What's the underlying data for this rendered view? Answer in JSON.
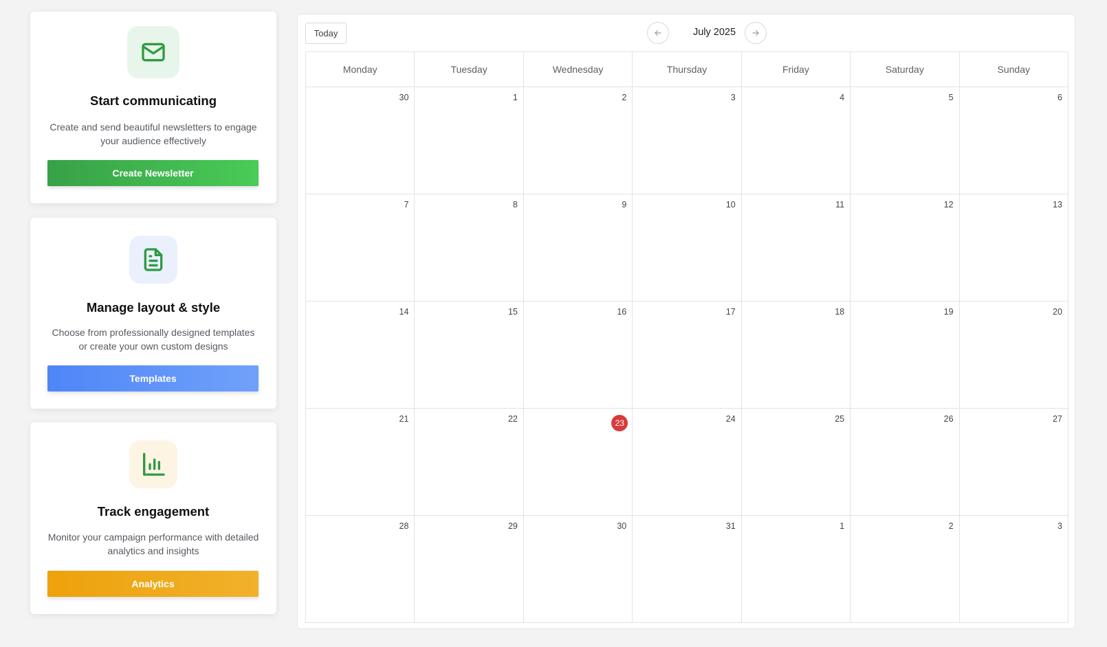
{
  "cards": [
    {
      "title": "Start communicating",
      "description": "Create and send beautiful newsletters to engage your audience effectively",
      "button": "Create Newsletter",
      "icon": "mail-icon"
    },
    {
      "title": "Manage layout & style",
      "description": "Choose from professionally designed templates or create your own custom designs",
      "button": "Templates",
      "icon": "document-icon"
    },
    {
      "title": "Track engagement",
      "description": "Monitor your campaign performance with detailed analytics and insights",
      "button": "Analytics",
      "icon": "bar-chart-icon"
    }
  ],
  "colors": {
    "green": "#37a147",
    "blue": "#4f86f7",
    "orange": "#eea20b",
    "today": "#d93a3a"
  },
  "calendar": {
    "today_label": "Today",
    "month_label": "July 2025",
    "prev_icon": "arrow-left-icon",
    "next_icon": "arrow-right-icon",
    "weekdays": [
      "Monday",
      "Tuesday",
      "Wednesday",
      "Thursday",
      "Friday",
      "Saturday",
      "Sunday"
    ],
    "weeks": [
      [
        "30",
        "1",
        "2",
        "3",
        "4",
        "5",
        "6"
      ],
      [
        "7",
        "8",
        "9",
        "10",
        "11",
        "12",
        "13"
      ],
      [
        "14",
        "15",
        "16",
        "17",
        "18",
        "19",
        "20"
      ],
      [
        "21",
        "22",
        "23",
        "24",
        "25",
        "26",
        "27"
      ],
      [
        "28",
        "29",
        "30",
        "31",
        "1",
        "2",
        "3"
      ]
    ],
    "today_date": "23"
  }
}
